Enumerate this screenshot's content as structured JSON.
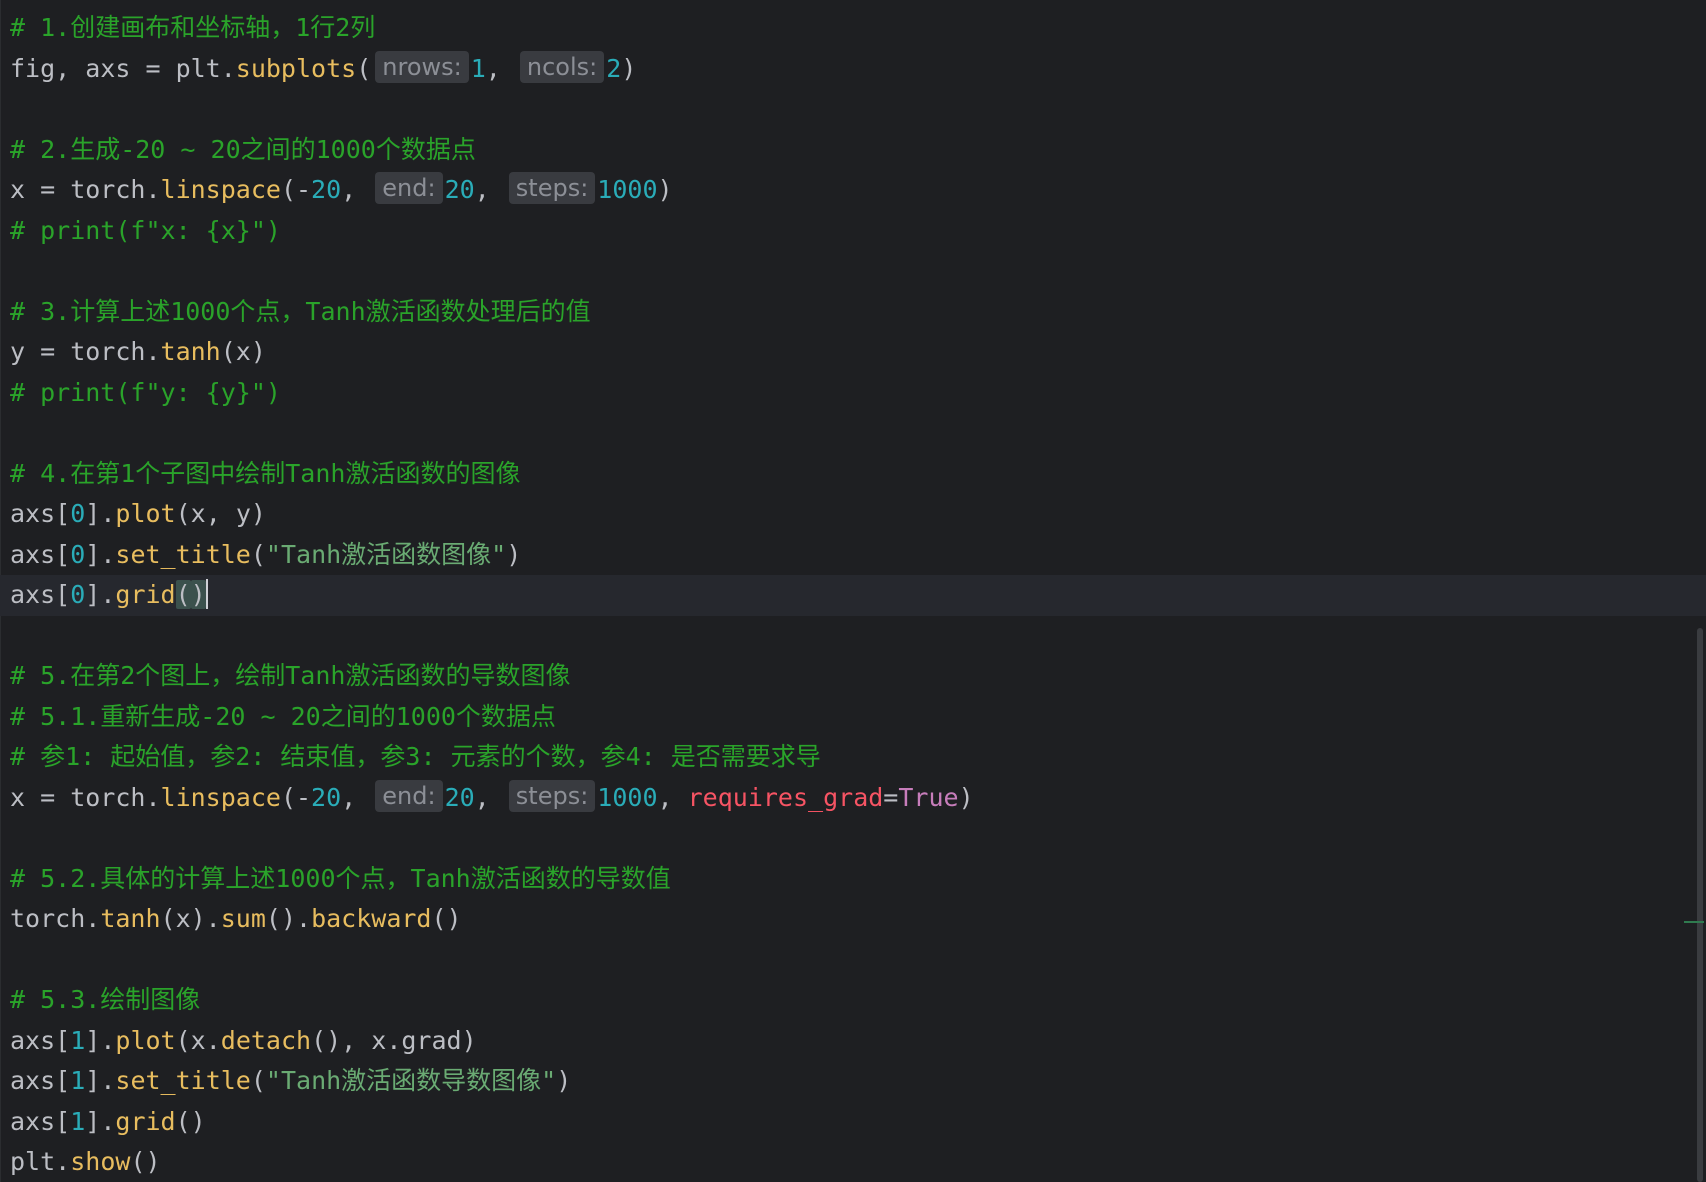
{
  "lines": [
    {
      "segments": [
        {
          "t": "# 1.创建画布和坐标轴，1行2列",
          "c": "cm"
        }
      ]
    },
    {
      "segments": [
        {
          "t": "fig, axs = plt."
        },
        {
          "t": "subplots",
          "c": "fn"
        },
        {
          "t": "("
        },
        {
          "hint": "nrows:"
        },
        {
          "t": "1",
          "c": "num"
        },
        {
          "t": ", "
        },
        {
          "hint": "ncols:"
        },
        {
          "t": "2",
          "c": "num"
        },
        {
          "t": ")"
        }
      ]
    },
    {
      "segments": []
    },
    {
      "segments": [
        {
          "t": "# 2.生成-20 ~ 20之间的1000个数据点",
          "c": "cm"
        }
      ]
    },
    {
      "segments": [
        {
          "t": "x = torch."
        },
        {
          "t": "linspace",
          "c": "fn"
        },
        {
          "t": "(-"
        },
        {
          "t": "20",
          "c": "num"
        },
        {
          "t": ", "
        },
        {
          "hint": "end:"
        },
        {
          "t": "20",
          "c": "num"
        },
        {
          "t": ", "
        },
        {
          "hint": "steps:"
        },
        {
          "t": "1000",
          "c": "num"
        },
        {
          "t": ")"
        }
      ]
    },
    {
      "segments": [
        {
          "t": "# print(f\"x: {x}\")",
          "c": "cm"
        }
      ]
    },
    {
      "segments": []
    },
    {
      "segments": [
        {
          "t": "# 3.计算上述1000个点，Tanh激活函数处理后的值",
          "c": "cm"
        }
      ]
    },
    {
      "segments": [
        {
          "t": "y = torch."
        },
        {
          "t": "tanh",
          "c": "fn"
        },
        {
          "t": "(x)"
        }
      ]
    },
    {
      "segments": [
        {
          "t": "# print(f\"y: {y}\")",
          "c": "cm"
        }
      ]
    },
    {
      "segments": []
    },
    {
      "segments": [
        {
          "t": "# 4.在第1个子图中绘制Tanh激活函数的图像",
          "c": "cm"
        }
      ]
    },
    {
      "segments": [
        {
          "t": "axs["
        },
        {
          "t": "0",
          "c": "num"
        },
        {
          "t": "]."
        },
        {
          "t": "plot",
          "c": "fn"
        },
        {
          "t": "(x, y)"
        }
      ]
    },
    {
      "segments": [
        {
          "t": "axs["
        },
        {
          "t": "0",
          "c": "num"
        },
        {
          "t": "]."
        },
        {
          "t": "set_title",
          "c": "fn"
        },
        {
          "t": "("
        },
        {
          "t": "\"Tanh激活函数图像\"",
          "c": "str"
        },
        {
          "t": ")"
        }
      ]
    },
    {
      "current": true,
      "segments": [
        {
          "t": "axs["
        },
        {
          "t": "0",
          "c": "num"
        },
        {
          "t": "]."
        },
        {
          "t": "grid",
          "c": "fn"
        },
        {
          "t": "(",
          "c": "bracket-hl"
        },
        {
          "t": ")",
          "c": "bracket-hl"
        },
        {
          "caret": true
        }
      ]
    },
    {
      "segments": []
    },
    {
      "segments": [
        {
          "t": "# 5.在第2个图上，绘制Tanh激活函数的导数图像",
          "c": "cm"
        }
      ]
    },
    {
      "segments": [
        {
          "t": "# 5.1.重新生成-20 ~ 20之间的1000个数据点",
          "c": "cm"
        }
      ]
    },
    {
      "segments": [
        {
          "t": "# 参1: 起始值，参2: 结束值，参3: 元素的个数，参4: 是否需要求导",
          "c": "cm"
        }
      ]
    },
    {
      "segments": [
        {
          "t": "x = torch."
        },
        {
          "t": "linspace",
          "c": "fn"
        },
        {
          "t": "(-"
        },
        {
          "t": "20",
          "c": "num"
        },
        {
          "t": ", "
        },
        {
          "hint": "end:"
        },
        {
          "t": "20",
          "c": "num"
        },
        {
          "t": ", "
        },
        {
          "hint": "steps:"
        },
        {
          "t": "1000",
          "c": "num"
        },
        {
          "t": ", "
        },
        {
          "t": "requires_grad",
          "c": "param"
        },
        {
          "t": "="
        },
        {
          "t": "True",
          "c": "bool"
        },
        {
          "t": ")"
        }
      ]
    },
    {
      "segments": []
    },
    {
      "segments": [
        {
          "t": "# 5.2.具体的计算上述1000个点，Tanh激活函数的导数值",
          "c": "cm"
        }
      ]
    },
    {
      "segments": [
        {
          "t": "torch."
        },
        {
          "t": "tanh",
          "c": "fn"
        },
        {
          "t": "(x)."
        },
        {
          "t": "sum",
          "c": "fn"
        },
        {
          "t": "()."
        },
        {
          "t": "backward",
          "c": "fn"
        },
        {
          "t": "()"
        }
      ]
    },
    {
      "segments": []
    },
    {
      "segments": [
        {
          "t": "# 5.3.绘制图像",
          "c": "cm"
        }
      ]
    },
    {
      "segments": [
        {
          "t": "axs["
        },
        {
          "t": "1",
          "c": "num"
        },
        {
          "t": "]."
        },
        {
          "t": "plot",
          "c": "fn"
        },
        {
          "t": "(x."
        },
        {
          "t": "detach",
          "c": "fn"
        },
        {
          "t": "(), x.grad)"
        }
      ]
    },
    {
      "segments": [
        {
          "t": "axs["
        },
        {
          "t": "1",
          "c": "num"
        },
        {
          "t": "]."
        },
        {
          "t": "set_title",
          "c": "fn"
        },
        {
          "t": "("
        },
        {
          "t": "\"Tanh激活函数导数图像\"",
          "c": "str"
        },
        {
          "t": ")"
        }
      ]
    },
    {
      "segments": [
        {
          "t": "axs["
        },
        {
          "t": "1",
          "c": "num"
        },
        {
          "t": "]."
        },
        {
          "t": "grid",
          "c": "fn"
        },
        {
          "t": "()"
        }
      ]
    },
    {
      "segments": [
        {
          "t": "plt."
        },
        {
          "t": "show",
          "c": "fn"
        },
        {
          "t": "()"
        }
      ]
    }
  ],
  "colors": {
    "background": "#1e1f22",
    "text": "#bcbec4",
    "comment": "#2aa32a",
    "function": "#e8bd5f",
    "number": "#2aacb8",
    "string": "#6aab73",
    "named_param": "#f75464",
    "boolean": "#c77dbb",
    "inlay_hint_bg": "#393b40",
    "inlay_hint_text": "#8c8f96",
    "current_line": "#26282e",
    "bracket_highlight": "#3b514d"
  }
}
